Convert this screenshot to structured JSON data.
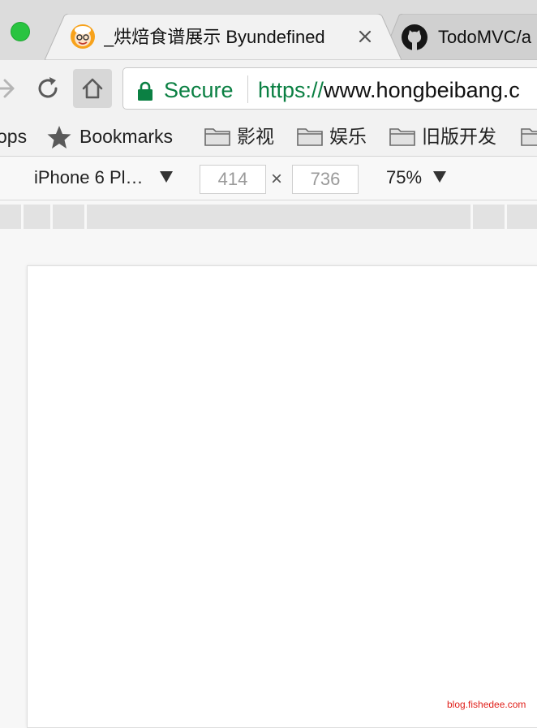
{
  "colors": {
    "secure_green": "#0b8043",
    "traffic_light_green": "#29c440",
    "watermark_red": "#e0201b"
  },
  "tabs": [
    {
      "title": "_烘焙食谱展示 Byundefined",
      "icon": "baker-favicon",
      "active": true
    },
    {
      "title": "TodoMVC/a",
      "icon": "github-icon",
      "active": false
    }
  ],
  "toolbar": {
    "secure_label": "Secure",
    "url_scheme": "https://",
    "url_host": "www.hongbeibang.c"
  },
  "bookmarks": {
    "apps_label": "ops",
    "bookmarks_label": "Bookmarks",
    "folders": [
      "影视",
      "娱乐",
      "旧版开发",
      ""
    ]
  },
  "device_toolbar": {
    "device": "iPhone 6 Pl…",
    "width": "414",
    "height": "736",
    "times": "×",
    "zoom": "75%"
  },
  "watermark": "blog.fishedee.com"
}
